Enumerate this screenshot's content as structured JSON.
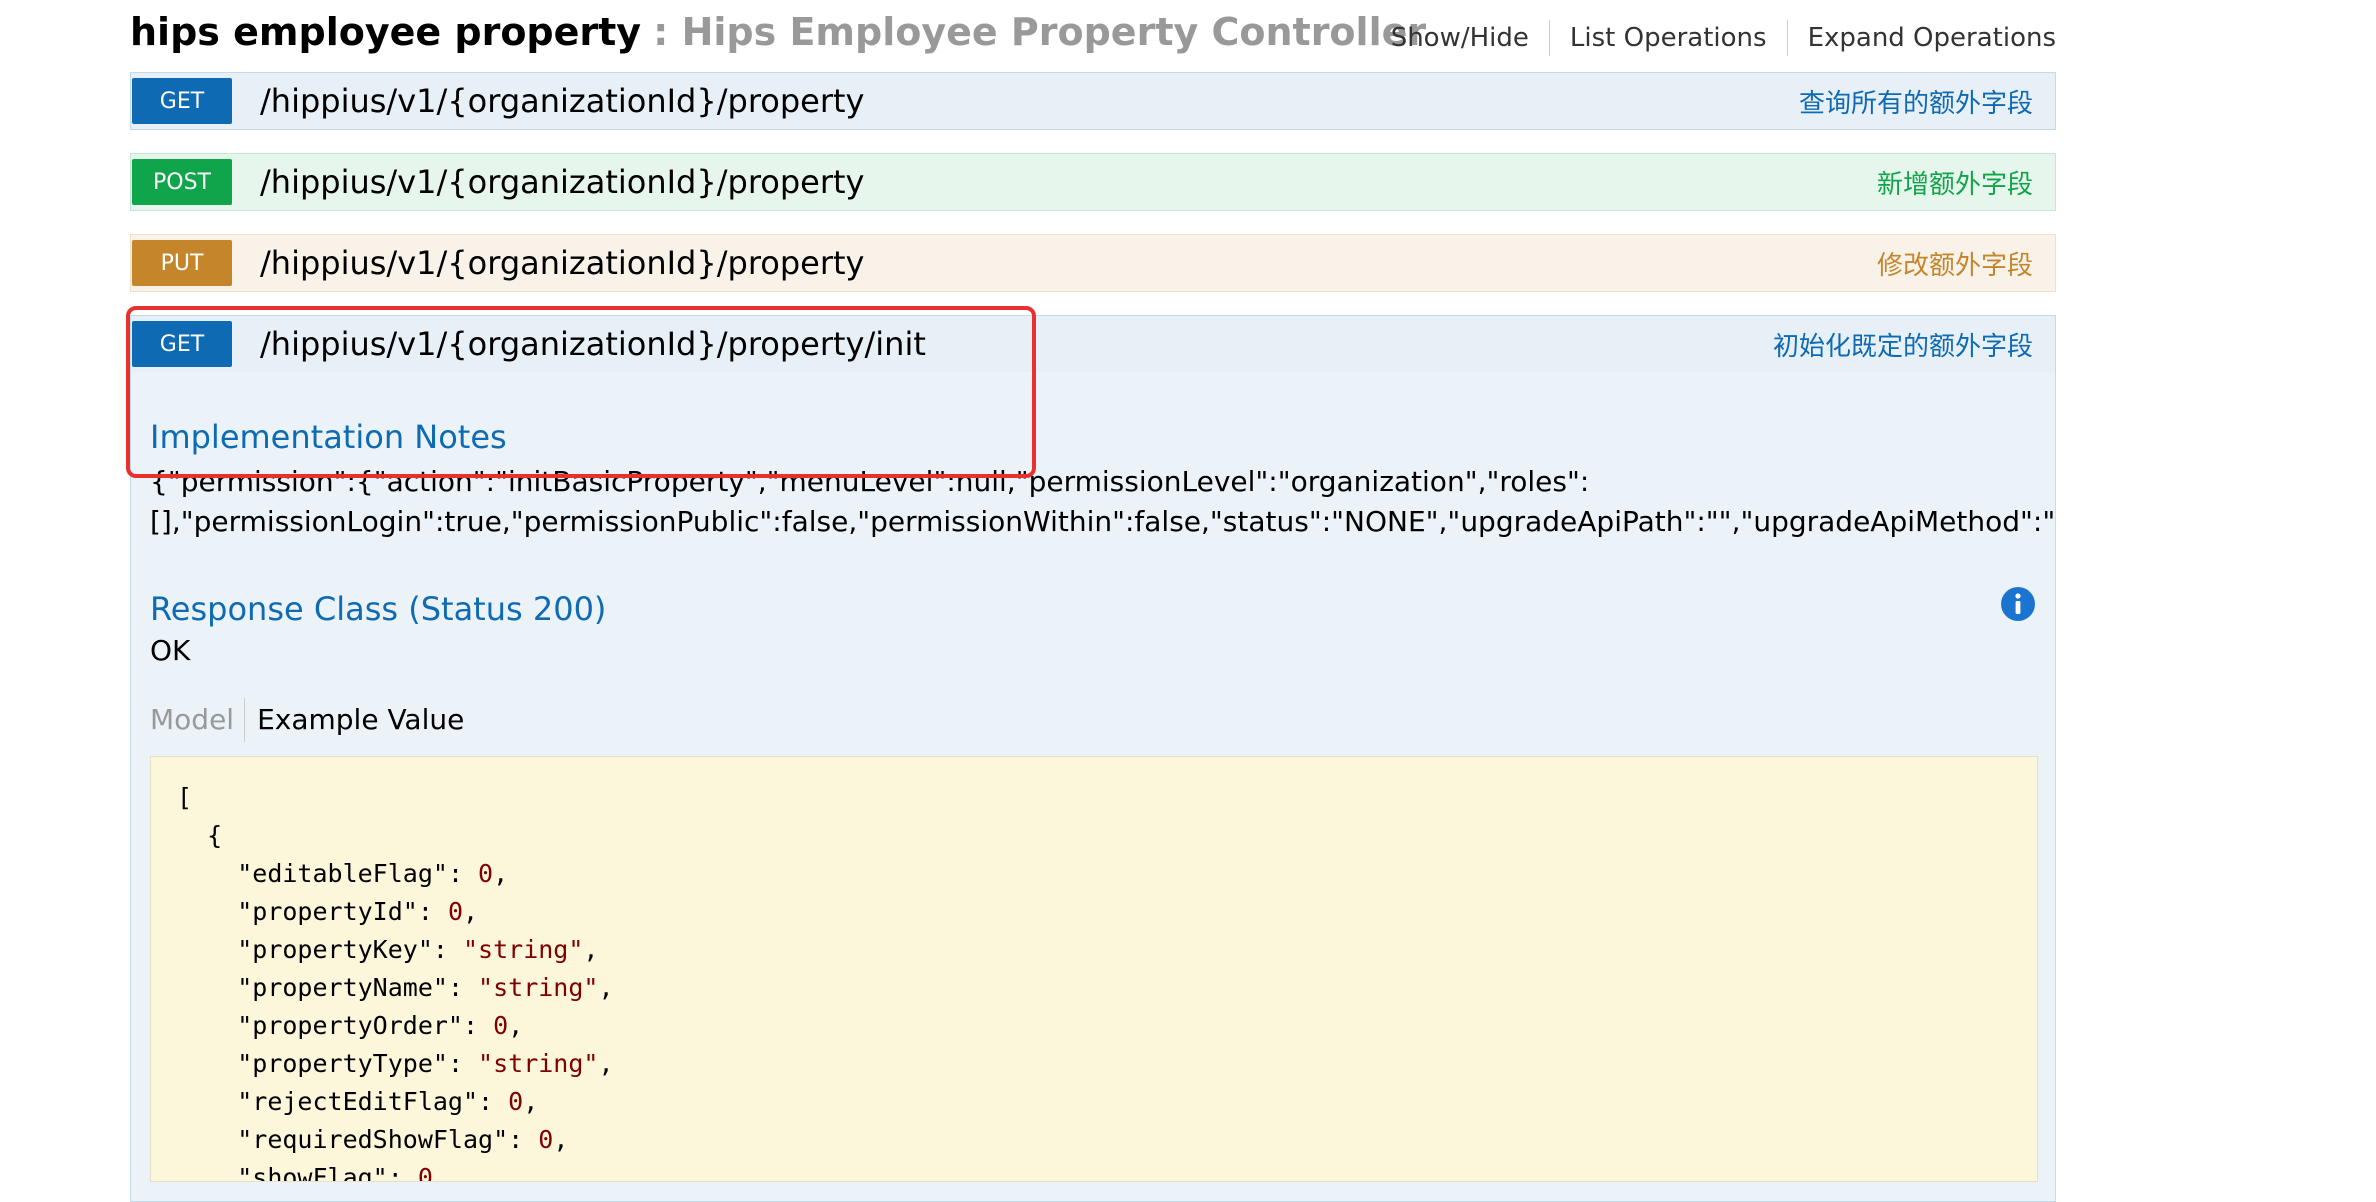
{
  "header": {
    "name": "hips employee property",
    "description": ": Hips Employee Property Controller",
    "operations": [
      "Show/Hide",
      "List Operations",
      "Expand Operations"
    ]
  },
  "endpoints": [
    {
      "method": "GET",
      "path": "/hippius/v1/{organizationId}/property",
      "summary": "查询所有的额外字段"
    },
    {
      "method": "POST",
      "path": "/hippius/v1/{organizationId}/property",
      "summary": "新增额外字段"
    },
    {
      "method": "PUT",
      "path": "/hippius/v1/{organizationId}/property",
      "summary": "修改额外字段"
    },
    {
      "method": "GET",
      "path": "/hippius/v1/{organizationId}/property/init",
      "summary": "初始化既定的额外字段"
    }
  ],
  "details": {
    "implementation_notes_title": "Implementation Notes",
    "notes_line1": "{\"permission\":{\"action\":\"initBasicProperty\",\"menuLevel\":null,\"permissionLevel\":\"organization\",\"roles\":",
    "notes_line2": "[],\"permissionLogin\":true,\"permissionPublic\":false,\"permissionWithin\":false,\"status\":\"NONE\",\"upgradeApiPath\":\"\",\"upgradeApiMethod\":\"GET\"},\"label",
    "response_class_title": "Response Class (Status 200)",
    "response_text": "OK",
    "tab_model": "Model",
    "tab_example": "Example Value",
    "example": {
      "open_bracket": "[",
      "open_brace": "{",
      "fields": [
        {
          "key": "\"editableFlag\"",
          "value": "0"
        },
        {
          "key": "\"propertyId\"",
          "value": "0"
        },
        {
          "key": "\"propertyKey\"",
          "value": "\"string\""
        },
        {
          "key": "\"propertyName\"",
          "value": "\"string\""
        },
        {
          "key": "\"propertyOrder\"",
          "value": "0"
        },
        {
          "key": "\"propertyType\"",
          "value": "\"string\""
        },
        {
          "key": "\"rejectEditFlag\"",
          "value": "0"
        },
        {
          "key": "\"requiredShowFlag\"",
          "value": "0"
        },
        {
          "key": "\"showFlag\"",
          "value": "0"
        }
      ]
    }
  },
  "colors": {
    "get": "#0f6ab4",
    "post": "#10a54a",
    "put": "#c5862b",
    "highlight": "#e8312f",
    "json_value": "#800000"
  },
  "icons": {
    "info": "info-circle-icon"
  }
}
